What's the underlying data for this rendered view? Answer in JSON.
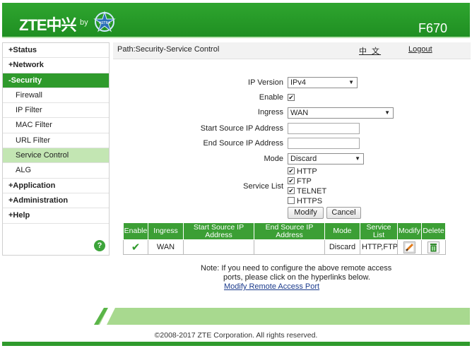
{
  "header": {
    "brand": "ZTE中兴",
    "by": "by",
    "partner_logo_text": "ASTRA",
    "model": "F670"
  },
  "sidebar": {
    "items": [
      {
        "label": "+Status",
        "type": "group"
      },
      {
        "label": "+Network",
        "type": "group"
      },
      {
        "label": "-Security",
        "type": "group",
        "active": true
      },
      {
        "label": "Firewall",
        "type": "sub"
      },
      {
        "label": "IP Filter",
        "type": "sub"
      },
      {
        "label": "MAC Filter",
        "type": "sub"
      },
      {
        "label": "URL Filter",
        "type": "sub"
      },
      {
        "label": "Service Control",
        "type": "sub",
        "active": true
      },
      {
        "label": "ALG",
        "type": "sub"
      },
      {
        "label": "+Application",
        "type": "group"
      },
      {
        "label": "+Administration",
        "type": "group"
      },
      {
        "label": "+Help",
        "type": "group"
      }
    ],
    "help_icon": "?"
  },
  "pathbar": {
    "path": "Path:Security-Service Control",
    "language": "中 文",
    "logout": "Logout"
  },
  "form": {
    "ip_version_label": "IP Version",
    "ip_version_value": "IPv4",
    "enable_label": "Enable",
    "enable_checked": true,
    "ingress_label": "Ingress",
    "ingress_value": "WAN",
    "start_ip_label": "Start Source IP Address",
    "start_ip_value": "",
    "end_ip_label": "End Source IP Address",
    "end_ip_value": "",
    "mode_label": "Mode",
    "mode_value": "Discard",
    "service_list_label": "Service List",
    "services": [
      {
        "label": "HTTP",
        "checked": true
      },
      {
        "label": "FTP",
        "checked": true
      },
      {
        "label": "TELNET",
        "checked": true
      },
      {
        "label": "HTTPS",
        "checked": false
      }
    ],
    "modify_button": "Modify",
    "cancel_button": "Cancel"
  },
  "table": {
    "headers": [
      "Enable",
      "Ingress",
      "Start Source IP Address",
      "End Source IP Address",
      "Mode",
      "Service List",
      "Modify",
      "Delete"
    ],
    "rows": [
      {
        "enable": "✔",
        "ingress": "WAN",
        "start_ip": "",
        "end_ip": "",
        "mode": "Discard",
        "service_list": "HTTP,FTP,TELNET"
      }
    ]
  },
  "note": {
    "line1": "Note: If you need to configure the above remote access",
    "line2": "ports, please click on the hyperlinks below.",
    "link": "Modify Remote Access Port"
  },
  "footer": {
    "copyright": "©2008-2017 ZTE Corporation. All rights reserved."
  },
  "colors": {
    "brand_green": "#2f9a2c",
    "active_sub": "#c3e6b3"
  }
}
